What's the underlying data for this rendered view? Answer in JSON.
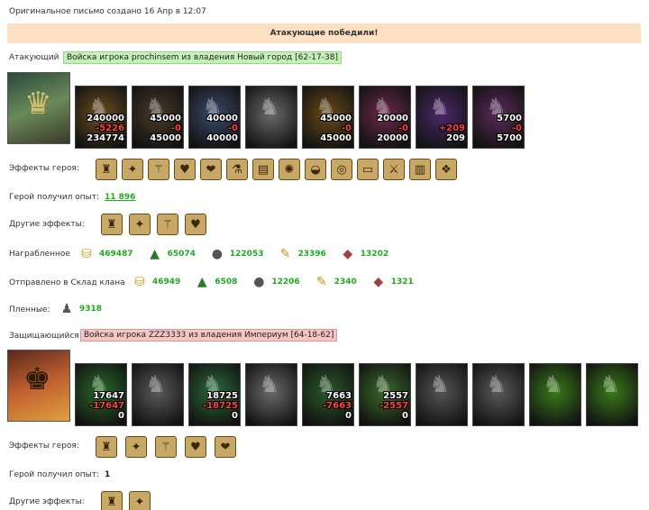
{
  "header": {
    "created": "Оригинальное письмо создано 16 Апр в 12:07",
    "result": "Атакующие победили!"
  },
  "attacker": {
    "role_label": "Атакующий",
    "tag": "Войска игрока prochinsem из владения Новый город [62-17-38]",
    "hero_icon": "hero-sorceress-portrait",
    "units": [
      {
        "icon": "unit-bear-rider",
        "before": "240000",
        "loss": "-5226",
        "after": "234774",
        "color": "#6b5020"
      },
      {
        "icon": "unit-assassin",
        "before": "45000",
        "loss": "-0",
        "after": "45000",
        "color": "#4a3a2a"
      },
      {
        "icon": "unit-dwarf-warrior",
        "before": "40000",
        "loss": "-0",
        "after": "40000",
        "color": "#3a4a6a"
      },
      {
        "icon": "unit-griffin-grey",
        "before": "",
        "loss": "",
        "after": "",
        "color": "#6a6a6a"
      },
      {
        "icon": "unit-archer",
        "before": "45000",
        "loss": "-0",
        "after": "45000",
        "color": "#6b4a18"
      },
      {
        "icon": "unit-warlock",
        "before": "20000",
        "loss": "-0",
        "after": "20000",
        "color": "#6a2a4a"
      },
      {
        "icon": "unit-dark-mage",
        "before": "",
        "loss": "+209",
        "after": "209",
        "color": "#4a2a6a"
      },
      {
        "icon": "unit-shadow-lord",
        "before": "5700",
        "loss": "-0",
        "after": "5700",
        "color": "#5a2a5a"
      }
    ],
    "hero_effects_label": "Эффекты героя:",
    "hero_effects": [
      "helmet-icon",
      "rune-icon",
      "staff-icon",
      "heart-icon",
      "hearts-icon",
      "potion-icon",
      "barrel-icon",
      "web-icon",
      "bucket-icon",
      "ring-icon",
      "scroll-icon",
      "sword-icon",
      "cage-icon",
      "crystal-icon"
    ],
    "xp_label": "Герой получил опыт:",
    "xp_value": "11 896",
    "other_effects_label": "Другие эффекты:",
    "other_effects": [
      "shield-heart-icon",
      "sword-scroll-icon",
      "bag-icon",
      "coins-bag-icon"
    ],
    "loot_label": "Награбленное",
    "loot": [
      {
        "icon": "gold-icon",
        "glyph": "⛁",
        "value": "469487",
        "color": "#c9a020"
      },
      {
        "icon": "wood-icon",
        "glyph": "▲",
        "value": "65074",
        "color": "#2a7a2a"
      },
      {
        "icon": "stone-icon",
        "glyph": "●",
        "value": "122053",
        "color": "#555555"
      },
      {
        "icon": "grain-icon",
        "glyph": "✎",
        "value": "23396",
        "color": "#c99020"
      },
      {
        "icon": "iron-icon",
        "glyph": "◆",
        "value": "13202",
        "color": "#a04040"
      }
    ],
    "clan_label": "Отправлено в Склад клана",
    "clan": [
      {
        "icon": "gold-icon",
        "glyph": "⛁",
        "value": "46949",
        "color": "#c9a020"
      },
      {
        "icon": "wood-icon",
        "glyph": "▲",
        "value": "6508",
        "color": "#2a7a2a"
      },
      {
        "icon": "stone-icon",
        "glyph": "●",
        "value": "12206",
        "color": "#555555"
      },
      {
        "icon": "grain-icon",
        "glyph": "✎",
        "value": "2340",
        "color": "#c99020"
      },
      {
        "icon": "iron-icon",
        "glyph": "◆",
        "value": "1321",
        "color": "#a04040"
      }
    ],
    "captives_label": "Пленные:",
    "captives_icon": "captive-icon",
    "captives_value": "9318"
  },
  "defender": {
    "role_label": "Защищающийся",
    "tag": "Войска игрока ZZZ3333 из владения Империум [64-18-62]",
    "hero_icon": "hero-musketeer-portrait",
    "units": [
      {
        "icon": "unit-dwarf-green",
        "before": "17647",
        "loss": "-17647",
        "after": "0",
        "color": "#2a6a2a"
      },
      {
        "icon": "unit-knight-grey",
        "before": "",
        "loss": "",
        "after": "",
        "color": "#5a5a5a"
      },
      {
        "icon": "unit-elf-warrior",
        "before": "18725",
        "loss": "-18725",
        "after": "0",
        "color": "#2a6a3a"
      },
      {
        "icon": "unit-griffin-grey",
        "before": "",
        "loss": "",
        "after": "",
        "color": "#6a6a6a"
      },
      {
        "icon": "unit-elf-archer",
        "before": "7663",
        "loss": "-7663",
        "after": "0",
        "color": "#2a5a2a"
      },
      {
        "icon": "unit-druid",
        "before": "2557",
        "loss": "-2557",
        "after": "0",
        "color": "#3a6a2a"
      },
      {
        "icon": "unit-ent-grey",
        "before": "",
        "loss": "",
        "after": "",
        "color": "#555555"
      },
      {
        "icon": "unit-treant-grey",
        "before": "",
        "loss": "",
        "after": "",
        "color": "#5a5a5a"
      },
      {
        "icon": "unit-tower",
        "before": "",
        "loss": "",
        "after": "",
        "color": "#3a7a1a"
      },
      {
        "icon": "unit-tower",
        "before": "",
        "loss": "",
        "after": "",
        "color": "#3a7a1a"
      }
    ],
    "hero_effects_label": "Эффекты героя:",
    "hero_effects": [
      "armor-icon",
      "gauntlet-icon",
      "amulet-icon",
      "bow-icon",
      "heart-shield-icon"
    ],
    "xp_label": "Герой получил опыт:",
    "xp_value": "1",
    "other_effects_label": "Другие эффекты:",
    "other_effects": [
      "sword-scroll-icon",
      "castle-icon"
    ]
  }
}
